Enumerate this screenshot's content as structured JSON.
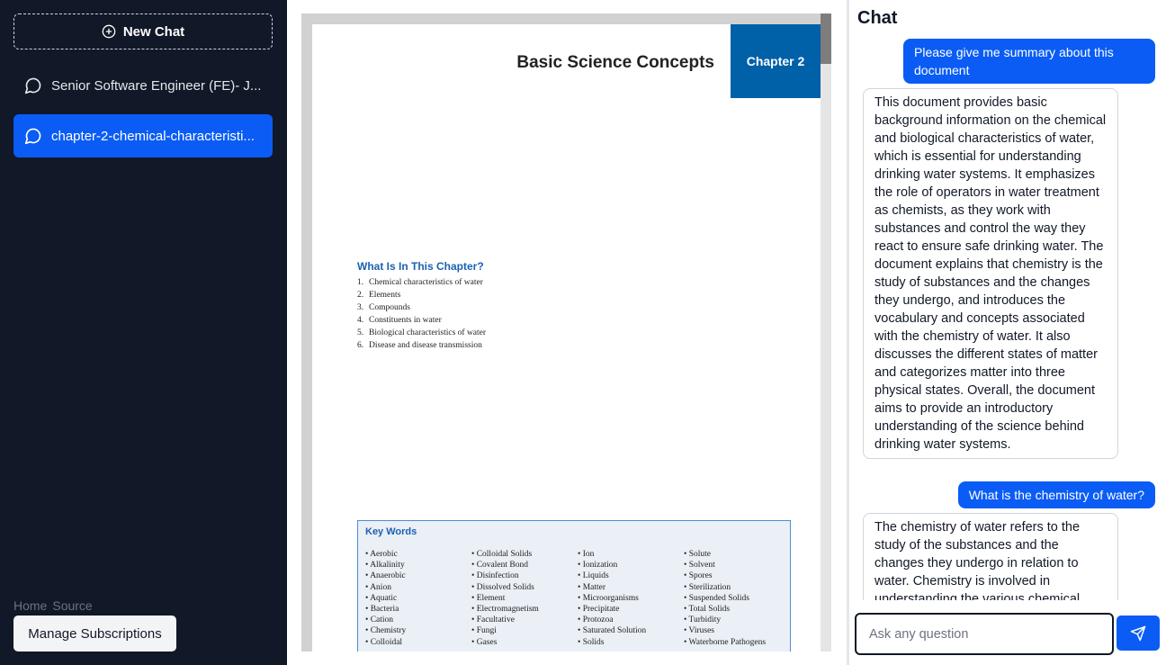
{
  "sidebar": {
    "new_chat_label": "New Chat",
    "chats": [
      {
        "label": "Senior Software Engineer (FE)- J..."
      },
      {
        "label": "chapter-2-chemical-characteristi..."
      }
    ],
    "footer_links": [
      "Home",
      "Source"
    ],
    "manage_label": "Manage Subscriptions"
  },
  "document": {
    "title": "Basic Science Concepts",
    "chapter_tab": "Chapter 2",
    "chapter_heading": "What Is In This Chapter?",
    "chapter_items": [
      {
        "num": "1.",
        "text": "Chemical characteristics of water"
      },
      {
        "num": "2.",
        "text": "Elements"
      },
      {
        "num": "3.",
        "text": "Compounds"
      },
      {
        "num": "4.",
        "text": "Constituents in water"
      },
      {
        "num": "5.",
        "text": "Biological characteristics of water"
      },
      {
        "num": "6.",
        "text": "Disease and disease transmission"
      }
    ],
    "key_words_title": "Key Words",
    "key_words": [
      [
        "Aerobic",
        "Alkalinity",
        "Anaerobic",
        "Anion",
        "Aquatic",
        "Bacteria",
        "Cation",
        "Chemistry",
        "Colloidal"
      ],
      [
        "Colloidal Solids",
        "Covalent Bond",
        "Disinfection",
        "Dissolved Solids",
        "Element",
        "Electromagnetism",
        "Facultative",
        "Fungi",
        "Gases"
      ],
      [
        "Ion",
        "Ionization",
        "Liquids",
        "Matter",
        "Microorganisms",
        "Precipitate",
        "Protozoa",
        "Saturated Solution",
        "Solids"
      ],
      [
        "Solute",
        "Solvent",
        "Spores",
        "Sterilization",
        "Suspended Solids",
        "Total Solids",
        "Turbidity",
        "Viruses",
        "Waterborne Pathogens"
      ]
    ]
  },
  "chat": {
    "title": "Chat",
    "messages": [
      {
        "role": "user",
        "text": "Please give me summary about this document"
      },
      {
        "role": "assistant",
        "text": "This document provides basic background information on the chemical and biological characteristics of water, which is essential for understanding drinking water systems. It emphasizes the role of operators in water treatment as chemists, as they work with substances and control the way they react to ensure safe drinking water. The document explains that chemistry is the study of substances and the changes they undergo, and introduces the vocabulary and concepts associated with the chemistry of water. It also discusses the different states of matter and categorizes matter into three physical states. Overall, the document aims to provide an introductory understanding of the science behind drinking water systems."
      },
      {
        "role": "user",
        "text": "What is the chemistry of water?"
      },
      {
        "role": "assistant",
        "text": "The chemistry of water refers to the study of the substances and the changes they undergo in relation to water. Chemistry is involved in understanding the various chemical"
      }
    ],
    "input_placeholder": "Ask any question"
  },
  "colors": {
    "sidebar_bg": "#111827",
    "accent": "#0a5cf5",
    "chapter_tab": "#0060a8"
  }
}
